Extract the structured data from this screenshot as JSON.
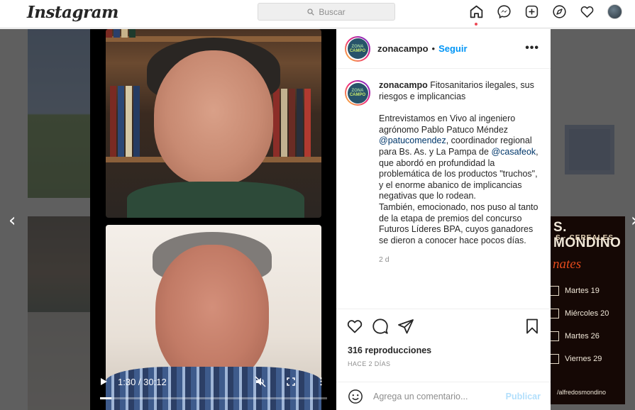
{
  "topbar": {
    "logo": "Instagram",
    "search_placeholder": "Buscar",
    "icons": [
      "home-icon",
      "messenger-icon",
      "new-post-icon",
      "explore-icon",
      "activity-heart-icon",
      "profile-avatar"
    ]
  },
  "background": {
    "ad_title": "S. MONDINO",
    "ad_subtitle": "S · CEREALES",
    "ad_script": "nates",
    "ad_dates": [
      "Martes 19",
      "Miércoles 20",
      "Martes 26",
      "Viernes 29"
    ],
    "ad_footer": "/alfredosmondino"
  },
  "video": {
    "time": "1:30 / 30:12",
    "progress": 0.05,
    "controls": [
      "play-icon",
      "mute-icon",
      "fullscreen-icon",
      "more-icon"
    ]
  },
  "post": {
    "username": "zonacampo",
    "dot": "•",
    "follow": "Seguir",
    "more": "•••",
    "logo_line1": "ZONA",
    "logo_line2": "CAMPO",
    "caption_title": "Fitosanitarios ilegales, sus riesgos e implicancias",
    "caption_p1_a": "Entrevistamos en Vivo al ingeniero agrónomo Pablo Patuco Méndez",
    "caption_mention1": "@patucomendez",
    "caption_p1_b": ", coordinador regional para Bs. As. y La Pampa de",
    "caption_mention2": "@casafeok",
    "caption_p1_c": ", que abordó en profundidad la problemática de los productos \"truchos\", y el enorme abanico de implicancias negativas que lo rodean.",
    "caption_p2": "También, emocionado, nos puso al tanto de la etapa de premios del concurso Futuros Líderes BPA, cuyos ganadores se dieron a conocer hace pocos días.",
    "caption_time": "2 d",
    "views": "316 reproducciones",
    "posted_ago": "HACE 2 DÍAS",
    "comment_placeholder": "Agrega un comentario...",
    "publish": "Publicar"
  }
}
